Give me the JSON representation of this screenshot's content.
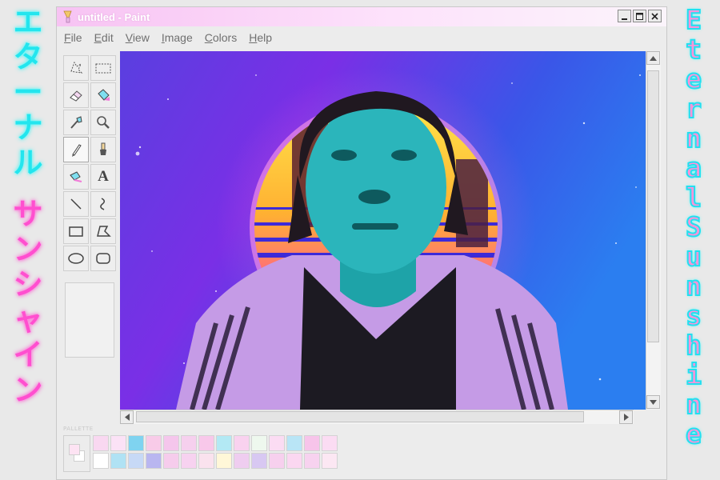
{
  "side_text": {
    "left_top": [
      "エ",
      "タ",
      "ー",
      "ナ",
      "ル"
    ],
    "left_bottom": [
      "サ",
      "ン",
      "シ",
      "ャ",
      "イ",
      "ン"
    ],
    "right": [
      "E",
      "t",
      "e",
      "r",
      "n",
      "a",
      "l",
      "S",
      "u",
      "n",
      "s",
      "h",
      "i",
      "n",
      "e"
    ]
  },
  "window": {
    "title": "untitled - Paint",
    "menu": [
      "File",
      "Edit",
      "View",
      "Image",
      "Colors",
      "Help"
    ]
  },
  "tools": [
    {
      "name": "free-select-icon"
    },
    {
      "name": "rect-select-icon"
    },
    {
      "name": "eraser-icon"
    },
    {
      "name": "fill-bucket-icon"
    },
    {
      "name": "color-picker-icon"
    },
    {
      "name": "magnifier-icon"
    },
    {
      "name": "pencil-icon"
    },
    {
      "name": "brush-icon"
    },
    {
      "name": "airbrush-icon"
    },
    {
      "name": "text-tool-icon",
      "label": "A"
    },
    {
      "name": "line-icon"
    },
    {
      "name": "curve-icon"
    },
    {
      "name": "rectangle-icon"
    },
    {
      "name": "polygon-icon"
    },
    {
      "name": "ellipse-icon"
    },
    {
      "name": "rounded-rect-icon"
    }
  ],
  "palette": {
    "label": "PALLETTE",
    "foreground": "#fde3f3",
    "background": "#ffffff",
    "colors": [
      "#f9d8f1",
      "#fbe2f6",
      "#7fd3f0",
      "#f8cbe8",
      "#f5c6ec",
      "#f6d0ee",
      "#f8c8ea",
      "#b3e9f4",
      "#f9d2ef",
      "#eef8ee",
      "#fbdcf3",
      "#b9e5f6",
      "#f7c4ea",
      "#fbdcf3",
      "#ffffff",
      "#b0e2f4",
      "#c7d9f6",
      "#b9b6f0",
      "#f6ccec",
      "#f7d2f0",
      "#fae2ee",
      "#fff7d8",
      "#efcdf0",
      "#d8c8f2",
      "#f7d0ee",
      "#fbd7f1",
      "#f7d2ef",
      "#fce7f3"
    ]
  },
  "colors": {
    "accent_cyan": "#23e5ee",
    "accent_pink": "#ff4fcf",
    "window_bg": "#ececec"
  }
}
